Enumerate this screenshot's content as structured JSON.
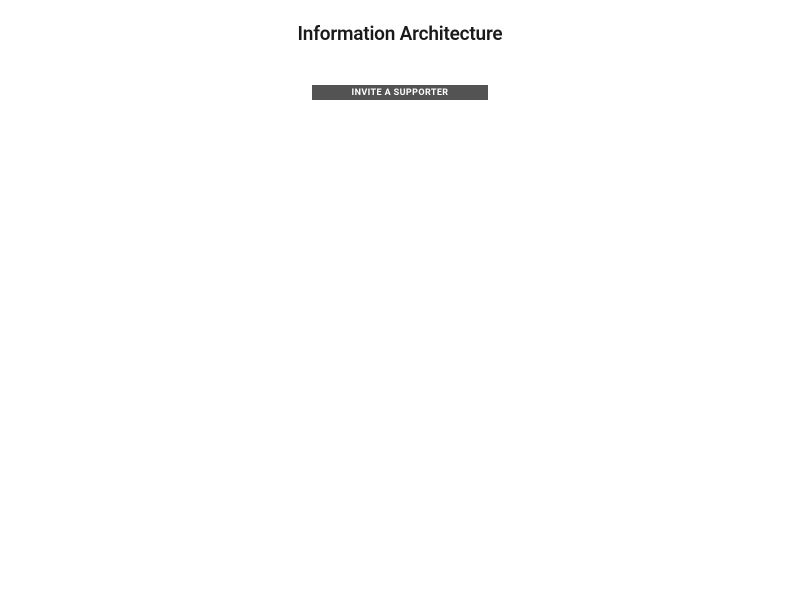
{
  "page": {
    "title": "Information Architecture"
  },
  "actions": {
    "invite_label": "INVITE A SUPPORTER"
  }
}
